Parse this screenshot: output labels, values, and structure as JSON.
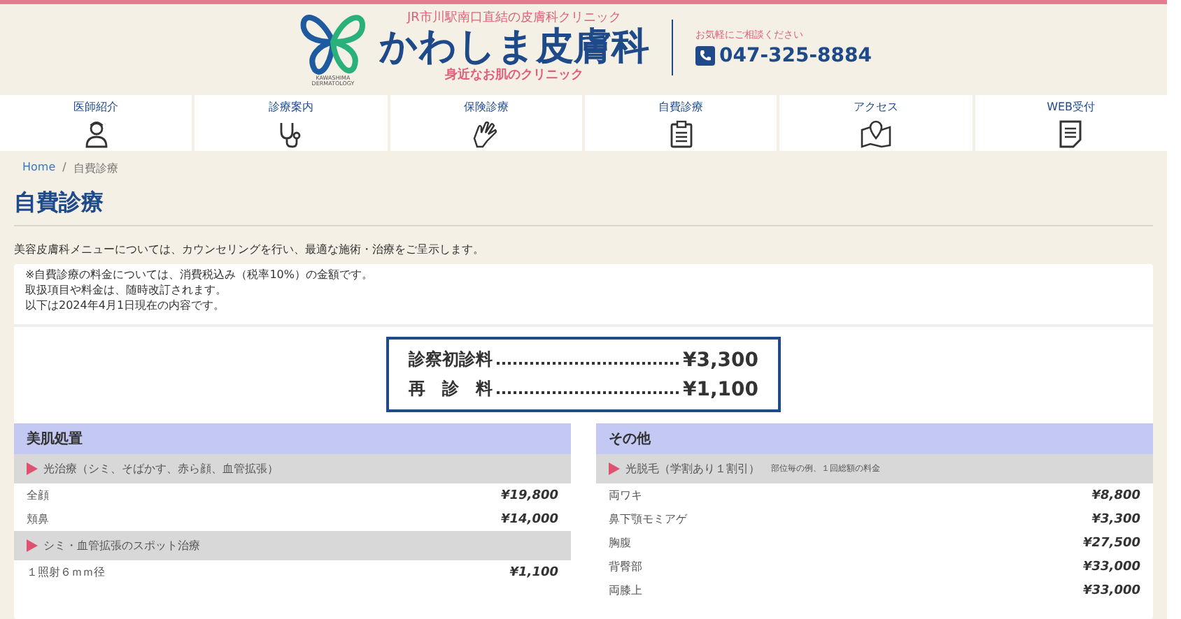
{
  "header": {
    "tagline": "JR市川駅南口直結の皮膚科クリニック",
    "clinic_name": "かわしま皮膚科",
    "subtitle": "身近なお肌のクリニック",
    "logo_caption": "KAWASHIMA DERMATOLOGY",
    "contact_note": "お気軽にご相談ください",
    "phone": "047-325-8884"
  },
  "nav": [
    {
      "label": "医師紹介"
    },
    {
      "label": "診療案内"
    },
    {
      "label": "保険診療"
    },
    {
      "label": "自費診療"
    },
    {
      "label": "アクセス"
    },
    {
      "label": "WEB受付"
    }
  ],
  "breadcrumb": {
    "separator": "/",
    "items": [
      "Home",
      "自費診療"
    ]
  },
  "title": "自費診療",
  "intro": "美容皮膚科メニューについては、カウンセリングを行い、最適な施術・治療をご呈示します。",
  "notes": [
    "※自費診療の料金については、消費税込み（税率10%）の金額です。",
    "取扱項目や料金は、随時改訂されます。",
    "以下は2024年4月1日現在の内容です。"
  ],
  "fees": [
    {
      "label": "診察初診料",
      "price": "¥3,300"
    },
    {
      "label": "再　診　料",
      "price": "¥1,100"
    }
  ],
  "sections": [
    {
      "title": "美肌処置",
      "groups": [
        {
          "title": "光治療（シミ、そばかす、赤ら顔、血管拡張）",
          "items": [
            {
              "name": "全顔",
              "price": "¥19,800"
            },
            {
              "name": "頬鼻",
              "price": "¥14,000"
            }
          ]
        },
        {
          "title": "シミ・血管拡張のスポット治療",
          "items": [
            {
              "name": "１照射６ｍｍ径",
              "price": "¥1,100"
            }
          ]
        }
      ]
    },
    {
      "title": "その他",
      "groups": [
        {
          "title": "光脱毛（学割あり１割引）",
          "note": "部位毎の例、１回総額の料金",
          "items": [
            {
              "name": "両ワキ",
              "price": "¥8,800"
            },
            {
              "name": "鼻下顎モミアゲ",
              "price": "¥3,300"
            },
            {
              "name": "胸腹",
              "price": "¥27,500"
            },
            {
              "name": "背臀部",
              "price": "¥33,000"
            },
            {
              "name": "両膝上",
              "price": "¥33,000"
            }
          ]
        }
      ]
    }
  ]
}
